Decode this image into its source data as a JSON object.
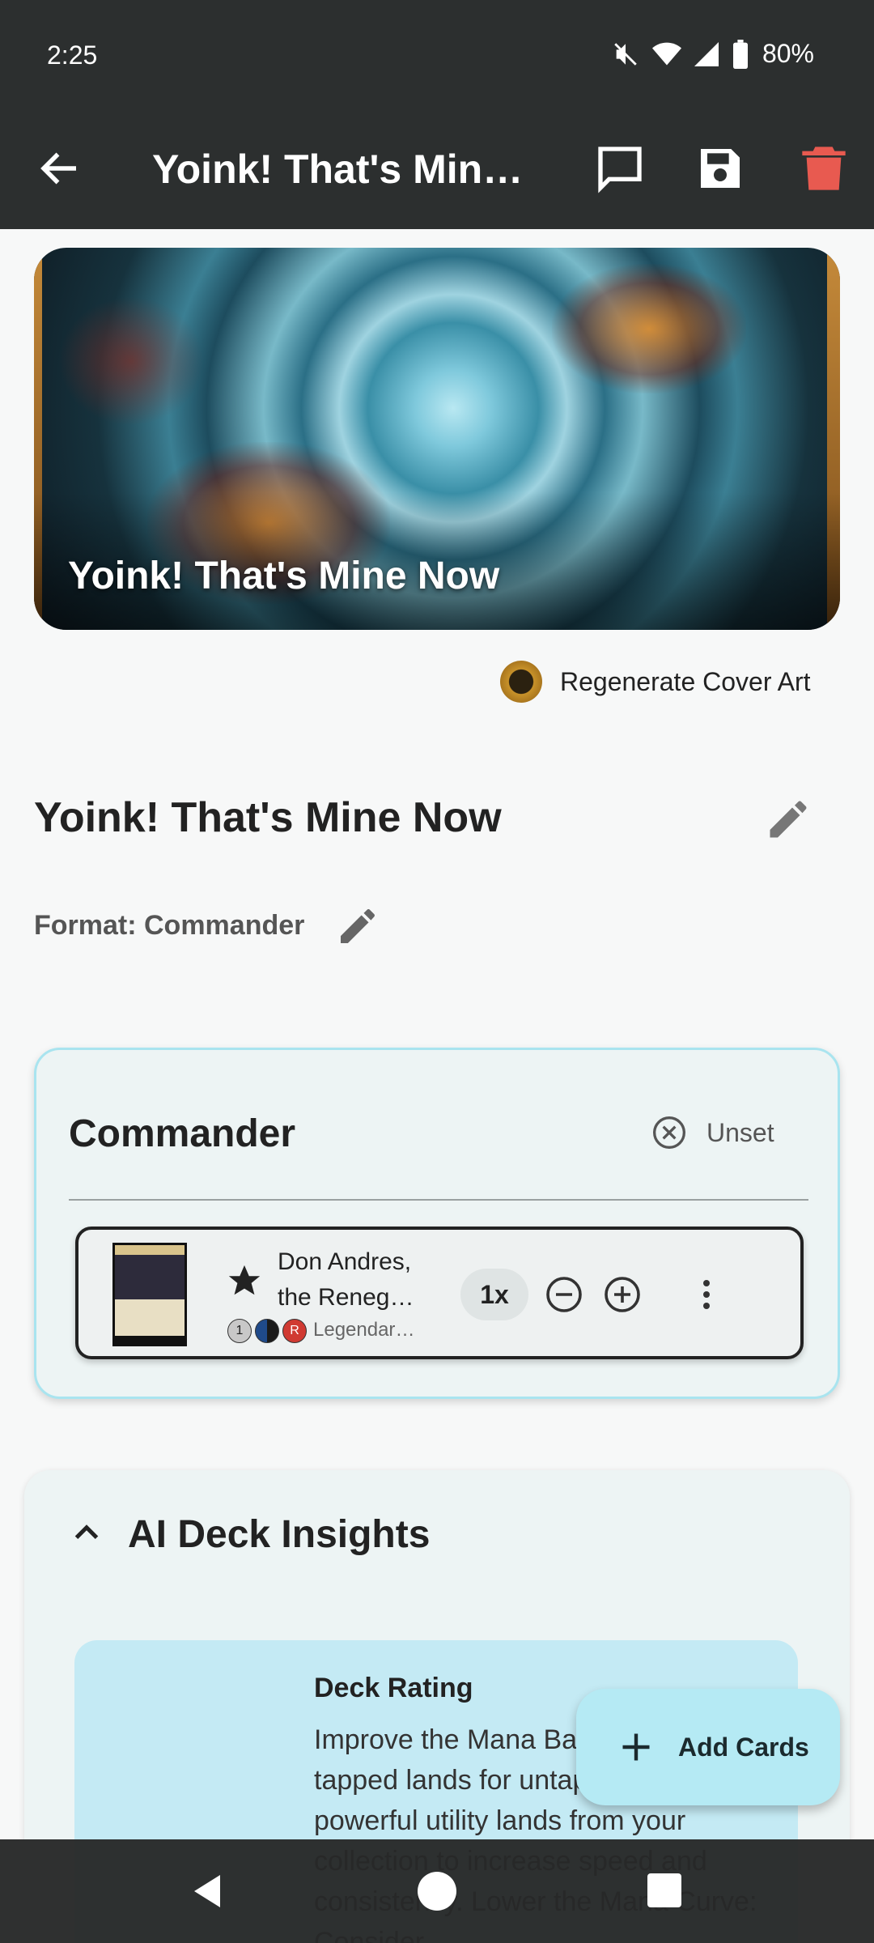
{
  "status_bar": {
    "time": "2:25",
    "battery": "80%",
    "icons": [
      "mute-icon",
      "wifi-icon",
      "signal-icon",
      "battery-icon"
    ]
  },
  "app_bar": {
    "title": "Yoink! That's Mine Now",
    "icons": [
      "back-arrow-icon",
      "chat-icon",
      "save-icon",
      "trash-icon"
    ],
    "delete_color": "#e85a50"
  },
  "cover": {
    "title": "Yoink! That's Mine Now",
    "regenerate_label": "Regenerate Cover Art"
  },
  "deck": {
    "name": "Yoink! That's Mine Now",
    "format": "Format: Commander"
  },
  "commander": {
    "heading": "Commander",
    "unset_label": "Unset",
    "card": {
      "name_line1": "Don Andres,",
      "name_line2": "the Renegade",
      "mana": [
        "1",
        "",
        "R"
      ],
      "type_line": "Legendary Creature",
      "quantity": "1x"
    }
  },
  "insights": {
    "title": "AI Deck Insights",
    "rating_title": "Deck Rating",
    "rating_text": "Improve the Mana Base by swapping tapped lands for untapped duals or powerful utility lands from your collection to increase speed and consistency. Lower the Mana Curve: Consider"
  },
  "fab": {
    "label": "Add Cards"
  },
  "colors": {
    "app_bar": "#2c2f2f",
    "accent": "#b5eaf4",
    "card_border": "#a9e4ef"
  }
}
